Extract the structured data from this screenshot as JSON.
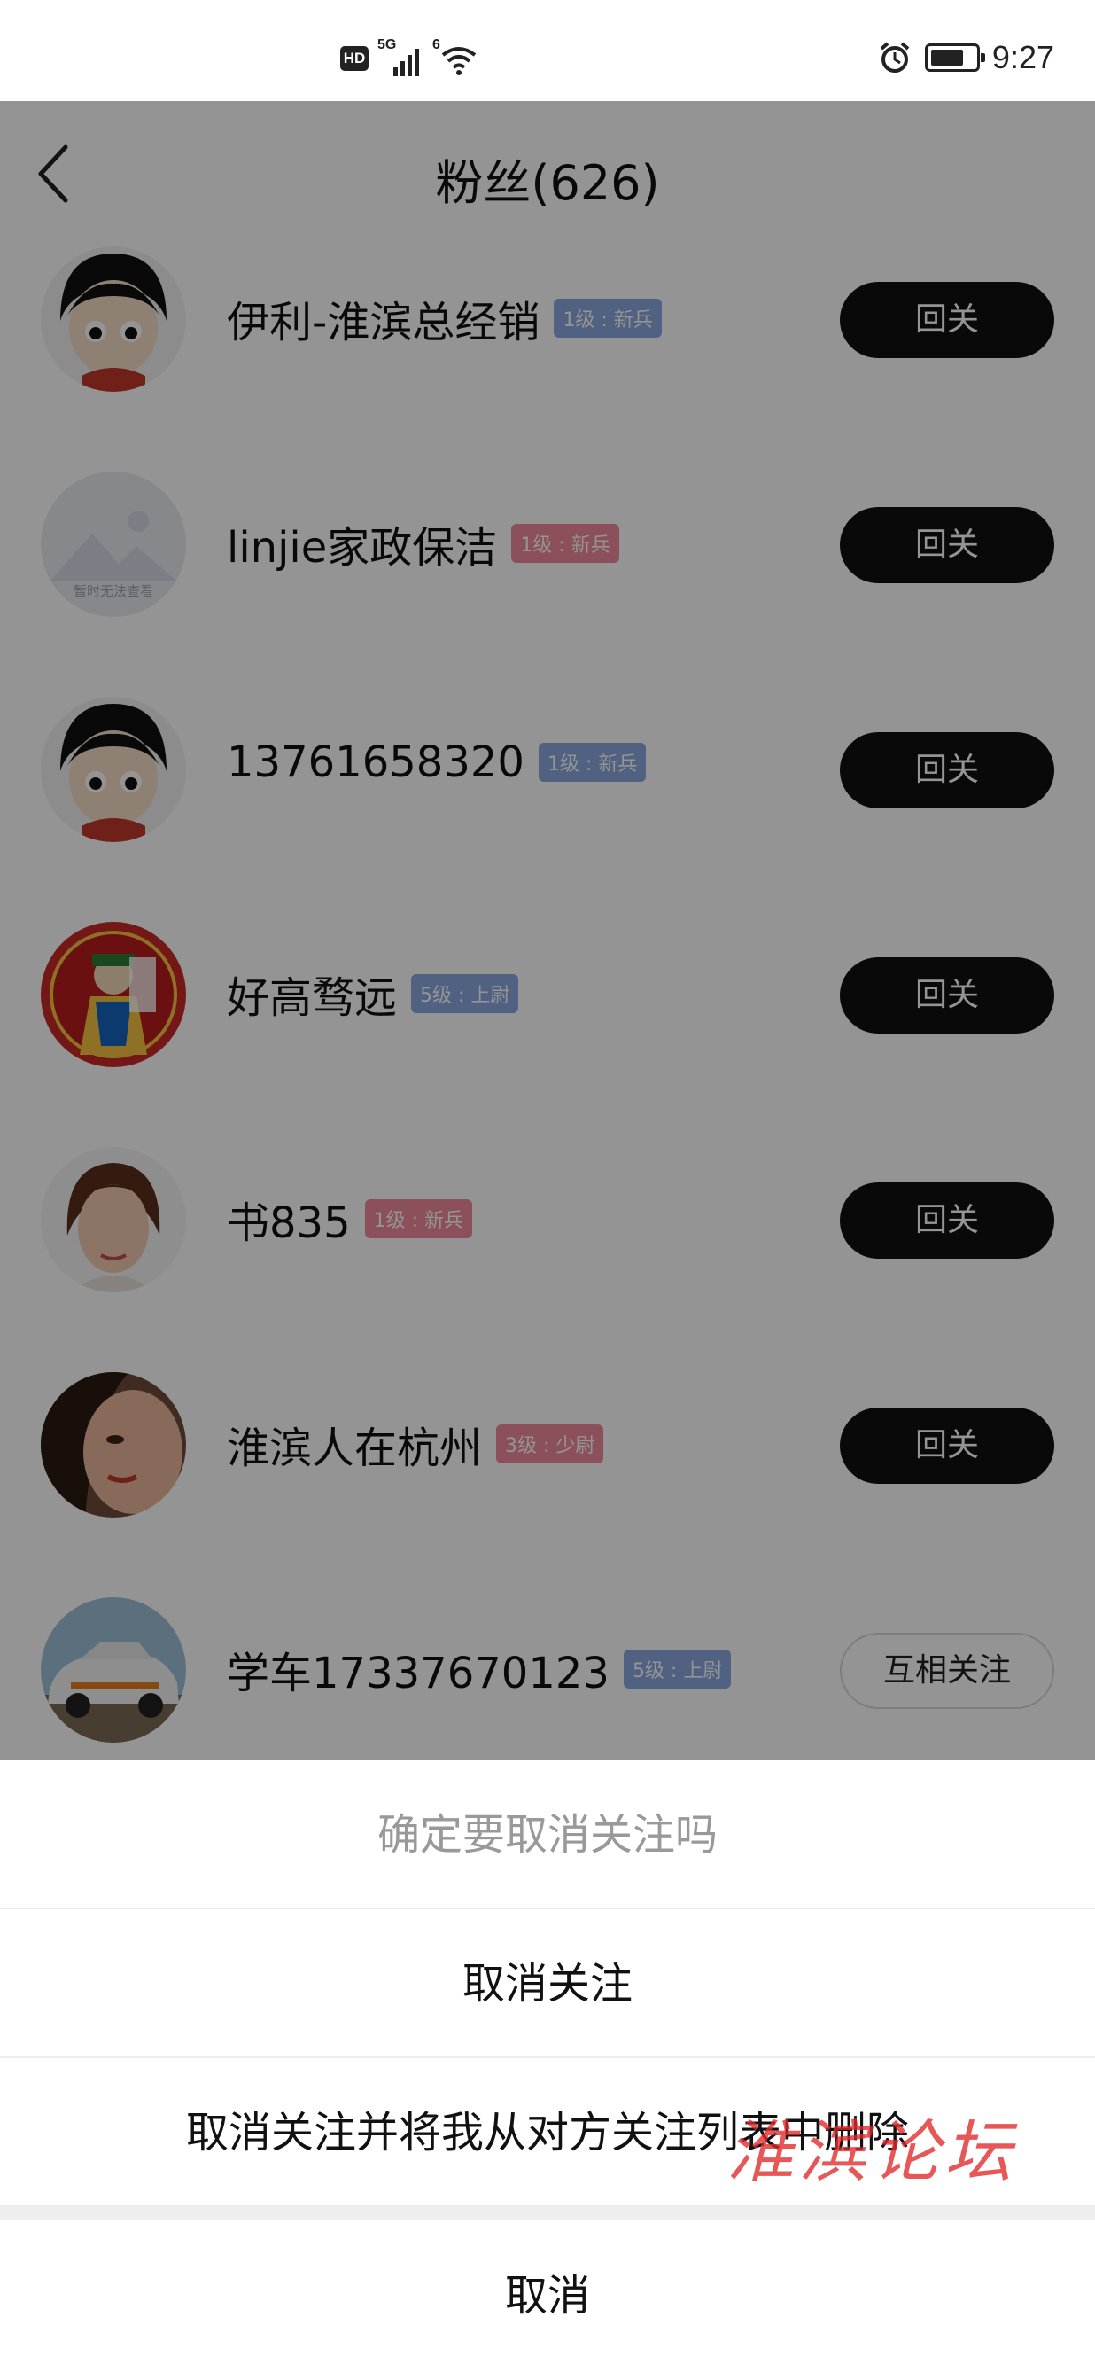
{
  "status_bar": {
    "hd_label": "HD",
    "signal_tag": "5G",
    "wifi_tag": "6",
    "time": "9:27",
    "icons": [
      "hd-icon",
      "signal-icon",
      "wifi-icon",
      "alarm-icon",
      "battery-icon"
    ]
  },
  "header": {
    "title": "粉丝(626)",
    "back_icon": "chevron-left-icon"
  },
  "fans": [
    {
      "name": "伊利-淮滨总经销",
      "level": "1级 : 新兵",
      "level_color": "#8aa7e0",
      "button": "回关",
      "avatar": "cartoon-girl"
    },
    {
      "name": "linjie家政保洁",
      "level": "1级 : 新兵",
      "level_color": "#f08a9a",
      "button": "回关",
      "avatar": "placeholder",
      "avatar_text": "暂时无法查看"
    },
    {
      "name": "13761658320",
      "level": "1级 : 新兵",
      "level_color": "#8aa7e0",
      "button": "回关",
      "avatar": "cartoon-girl"
    },
    {
      "name": "好高骛远",
      "level": "5级 : 上尉",
      "level_color": "#8aa7e0",
      "button": "回关",
      "avatar": "red-deity"
    },
    {
      "name": "书835",
      "level": "1级 : 新兵",
      "level_color": "#f08a9a",
      "button": "回关",
      "avatar": "woman-photo"
    },
    {
      "name": "淮滨人在杭州",
      "level": "3级 : 少尉",
      "level_color": "#f08a9a",
      "button": "回关",
      "avatar": "woman-face"
    },
    {
      "name": "学车17337670123",
      "level": "5级 : 上尉",
      "level_color": "#8aa7e0",
      "button": "互相关注",
      "avatar": "car-photo"
    }
  ],
  "action_sheet": {
    "title": "确定要取消关注吗",
    "option_unfollow": "取消关注",
    "option_unfollow_remove": "取消关注并将我从对方关注列表中删除",
    "cancel": "取消"
  },
  "watermark": "淮滨论坛"
}
